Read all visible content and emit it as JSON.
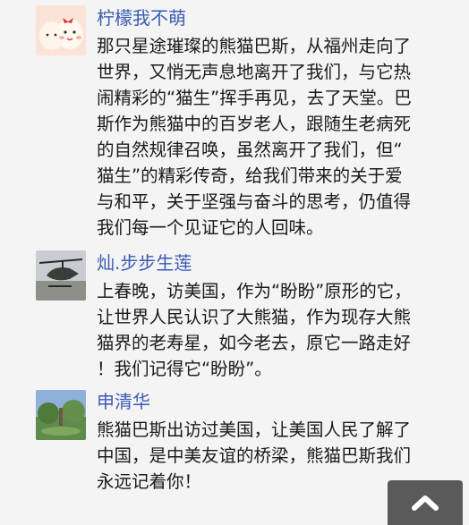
{
  "comments": [
    {
      "username": "柠檬我不萌",
      "avatar_icon": "cartoon-face-avatar-icon",
      "lines": [
        "那只星途璀璨的熊猫巴斯，从福州走向了",
        "世界，又悄无声息地离开了我们，与它热",
        "闹精彩的“猫生”挥手再见，去了天堂。巴",
        "斯作为熊猫中的百岁老人，跟随生老病死",
        "的自然规律召唤，虽然离开了我们，但“",
        "猫生”的精彩传奇，给我们带来的关于爱",
        "与和平，关于坚强与奋斗的思考，仍值得",
        "我们每一个见证它的人回味。"
      ]
    },
    {
      "username": "灿.步步生莲",
      "avatar_icon": "helicopter-avatar-icon",
      "lines": [
        "上春晚，访美国，作为“盼盼”原形的它，",
        "让世界人民认识了大熊猫，作为现存大熊",
        "猫界的老寿星，如今老去，原它一路走好",
        "！我们记得它“盼盼”。"
      ]
    },
    {
      "username": "申清华",
      "avatar_icon": "garden-landscape-avatar-icon",
      "lines": [
        "熊猫巴斯出访过美国，让美国人民了解了",
        "中国，是中美友谊的桥梁，熊猫巴斯我们",
        "永远记着你！"
      ]
    }
  ],
  "scroll_top_icon": "chevron-up-icon",
  "colors": {
    "background": "#f4f4f4",
    "username": "#3b5bb5",
    "text": "#1a1a1a",
    "scroll_button": "#5a5a5a"
  }
}
